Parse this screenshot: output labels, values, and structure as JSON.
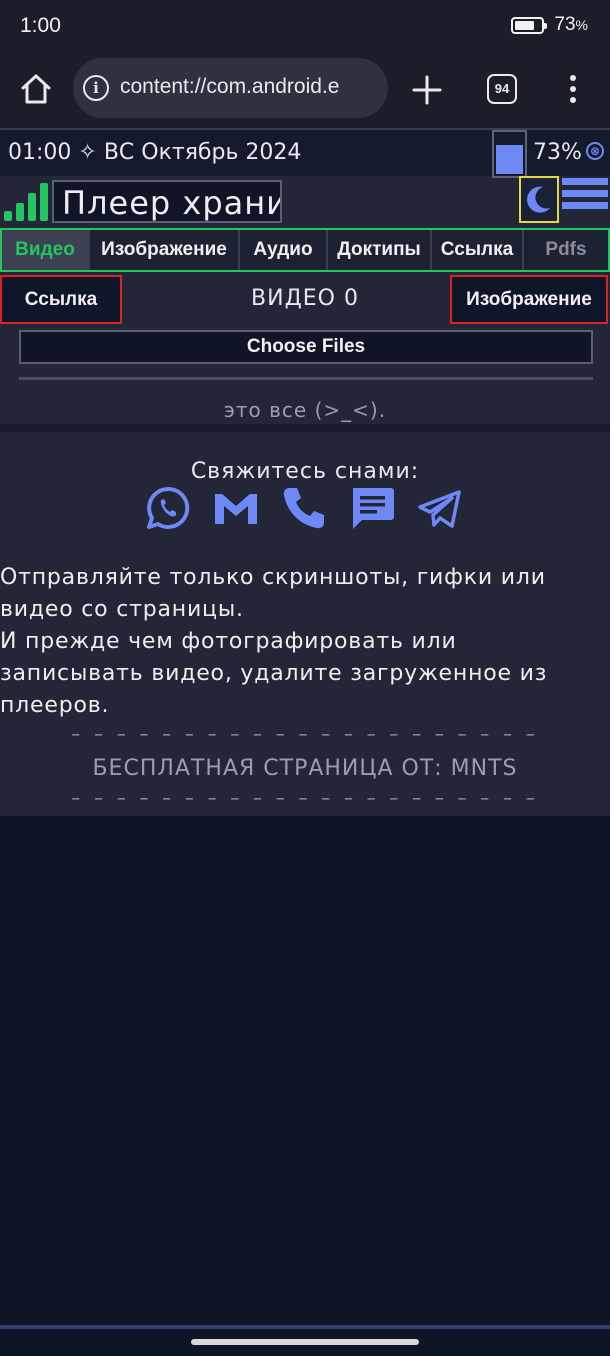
{
  "status_bar": {
    "time": "1:00",
    "battery": "73",
    "battery_unit": "%",
    "battery_level": 0.73
  },
  "browser": {
    "url": "content://com.android.e",
    "tab_count": "94"
  },
  "page": {
    "clock_line": "01:00 ✧ ВС Октябрь 2024",
    "battery": "73%",
    "battery_icon_glyph": "⊗",
    "title": "Плеер храни",
    "tabs": [
      {
        "label": "Видео",
        "active": true
      },
      {
        "label": "Изображение",
        "active": false
      },
      {
        "label": "Аудио",
        "active": false
      },
      {
        "label": "Доктипы",
        "active": false
      },
      {
        "label": "Ссылка",
        "active": false
      },
      {
        "label": "Pdfs",
        "active": false
      }
    ],
    "link_button": "Ссылка",
    "image_button": "Изображение",
    "video_count": "ВИДЕО 0",
    "choose_files": "Choose Files",
    "end_text": "это все (>_<).",
    "contact_title": "Свяжитесь снами:",
    "contact_icons": [
      "whatsapp-icon",
      "gmail-icon",
      "phone-icon",
      "chat-icon",
      "telegram-icon"
    ],
    "message": "Отправляйте только скриншоты, гифки или видео со страницы.\nИ прежде чем фотографировать или записывать видео, удалите загруженное из плееров.",
    "dashes": "– – – – – – – – – – – – – – – – – – – – –",
    "free_page": "БЕСПЛАТНАЯ СТРАНИЦА ОТ: MNTS"
  },
  "colors": {
    "accent_blue": "#6e88f5",
    "active_green": "#22c55e",
    "warning_red": "#d92424",
    "moon_border": "#e6d640",
    "page_bg": "#222636",
    "body_bg": "#0f1427"
  }
}
